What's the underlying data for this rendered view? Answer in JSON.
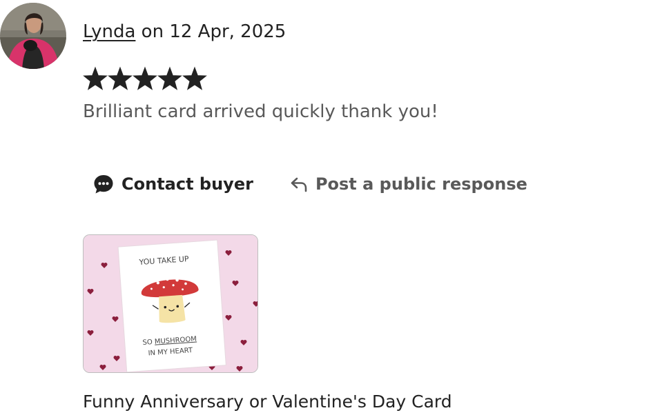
{
  "review": {
    "reviewer_name": "Lynda",
    "date_text": "on 12 Apr, 2025",
    "rating": 5,
    "max_rating": 5,
    "text": "Brilliant card arrived quickly thank you!"
  },
  "actions": {
    "contact_label": "Contact buyer",
    "respond_label": "Post a public response"
  },
  "product": {
    "title": "Funny Anniversary or Valentine's Day Card",
    "card_line1": "YOU TAKE UP",
    "card_line2_prefix": "SO ",
    "card_line2_emph": "MUSHROOM",
    "card_line3": "IN MY HEART"
  },
  "colors": {
    "text_primary": "#222222",
    "text_secondary": "#595959",
    "star": "#222222",
    "thumb_background": "#f3d9e8",
    "heart": "#8b1f3d",
    "mushroom_cap": "#d23a3a"
  },
  "icons": {
    "contact": "speech-bubble-icon",
    "respond": "reply-arrow-icon",
    "star": "star-icon"
  }
}
